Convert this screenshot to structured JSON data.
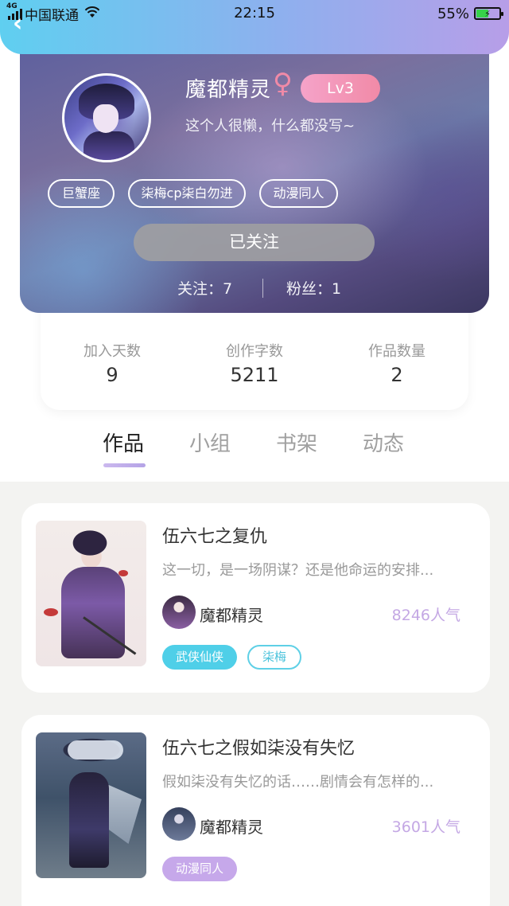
{
  "status_bar": {
    "network": "4G",
    "carrier": "中国联通",
    "time": "22:15",
    "battery": "55%",
    "battery_level": 0.55
  },
  "profile": {
    "username": "魔都精灵",
    "gender_icon": "female-icon",
    "level": "Lv3",
    "bio": "这个人很懒，什么都没写~",
    "tags": [
      "巨蟹座",
      "柒梅cp柒白勿进",
      "动漫同人"
    ],
    "follow_button": "已关注",
    "following_label": "关注：7",
    "followers_label": "粉丝：1"
  },
  "stats": [
    {
      "label": "加入天数",
      "value": "9"
    },
    {
      "label": "创作字数",
      "value": "5211"
    },
    {
      "label": "作品数量",
      "value": "2"
    }
  ],
  "tabs": [
    "作品",
    "小组",
    "书架",
    "动态"
  ],
  "active_tab": "作品",
  "works": [
    {
      "title": "伍六七之复仇",
      "description": "这一切，是一场阴谋？还是他命运的安排...",
      "author": "魔都精灵",
      "popularity": "8246人气",
      "tags": [
        {
          "label": "武侠仙侠",
          "style": "filled",
          "color": "#4fcfe8"
        },
        {
          "label": "柒梅",
          "style": "outline",
          "color": "#5fd0e6"
        }
      ]
    },
    {
      "title": "伍六七之假如柒没有失忆",
      "description": "假如柒没有失忆的话……剧情会有怎样的...",
      "author": "魔都精灵",
      "popularity": "3601人气",
      "tags": [
        {
          "label": "动漫同人",
          "style": "filled",
          "color": "#c6a8ea"
        }
      ]
    }
  ],
  "colors": {
    "header_gradient_start": "#5fcff0",
    "header_gradient_end": "#b79ee8",
    "level_badge": "#f18aa7",
    "popularity": "#c4a8e4",
    "tab_active_underline": "#b4a3e6"
  }
}
